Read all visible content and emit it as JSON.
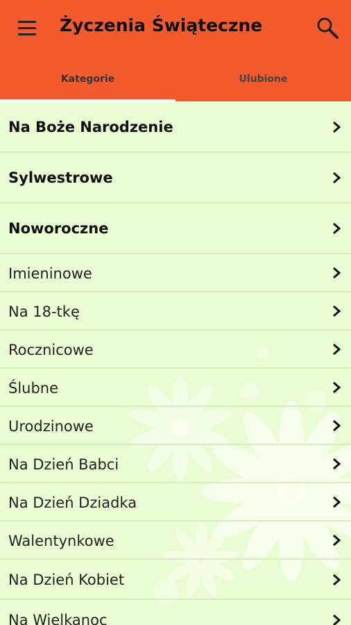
{
  "app": {
    "title": "Życzenia Świąteczne",
    "accent_color": "#f15b2e",
    "background_color": "#eafcd3"
  },
  "toolbar": {
    "menu_icon": "hamburger-menu-icon",
    "search_icon": "search-icon"
  },
  "tabs": [
    {
      "label": "Kategorie",
      "selected": true
    },
    {
      "label": "Ulubione",
      "selected": false
    }
  ],
  "categories": [
    {
      "label": "Na Boże Narodzenie",
      "bold": true
    },
    {
      "label": "Sylwestrowe",
      "bold": true
    },
    {
      "label": "Noworoczne",
      "bold": true
    },
    {
      "label": "Imieninowe",
      "bold": false
    },
    {
      "label": "Na 18-tkę",
      "bold": false
    },
    {
      "label": "Rocznicowe",
      "bold": false
    },
    {
      "label": "Ślubne",
      "bold": false
    },
    {
      "label": "Urodzinowe",
      "bold": false
    },
    {
      "label": "Na Dzień Babci",
      "bold": false
    },
    {
      "label": "Na Dzień Dziadka",
      "bold": false
    },
    {
      "label": "Walentynkowe",
      "bold": false
    },
    {
      "label": "Na Dzień Kobiet",
      "bold": false
    },
    {
      "label": "Na Wielkanoc",
      "bold": false
    }
  ]
}
